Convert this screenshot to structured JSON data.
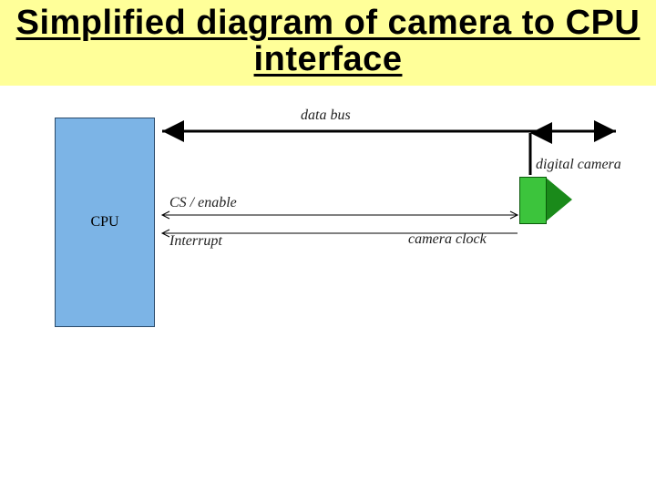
{
  "title": "Simplified diagram of camera to CPU interface",
  "blocks": {
    "cpu": "CPU",
    "camera_label": "digital camera"
  },
  "signals": {
    "data_bus": "data bus",
    "cs_enable": "CS / enable",
    "interrupt": "Interrupt",
    "camera_clock": "camera clock"
  }
}
